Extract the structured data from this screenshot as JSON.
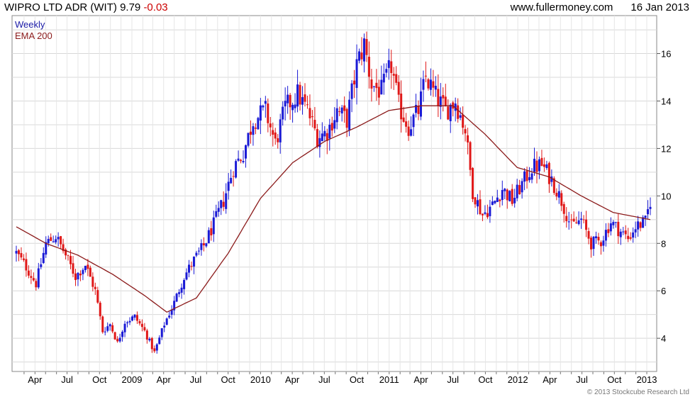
{
  "header": {
    "title": "WIPRO LTD ADR (WIT)",
    "last": "9.79",
    "change": "-0.03",
    "site": "www.fullermoney.com",
    "date": "16 Jan 2013"
  },
  "legend": {
    "weekly": "Weekly",
    "ema": "EMA 200"
  },
  "copyright": "© 2013 Stockcube Research Ltd",
  "colors": {
    "up": "#1a1ad6",
    "down": "#e01818",
    "ema": "#8b1a1a",
    "grid": "#d8d8d8"
  },
  "chart_data": {
    "type": "candlestick",
    "title": "WIPRO LTD ADR (WIT)",
    "frequency": "Weekly",
    "ylim": [
      2.6,
      17.6
    ],
    "yticks": [
      4,
      6,
      8,
      10,
      12,
      14,
      16
    ],
    "xticks": [
      {
        "label": "Apr",
        "date": "2008-04-01"
      },
      {
        "label": "Jul",
        "date": "2008-07-01"
      },
      {
        "label": "Oct",
        "date": "2008-10-01"
      },
      {
        "label": "2009",
        "date": "2009-01-01"
      },
      {
        "label": "Apr",
        "date": "2009-04-01"
      },
      {
        "label": "Jul",
        "date": "2009-07-01"
      },
      {
        "label": "Oct",
        "date": "2009-10-01"
      },
      {
        "label": "2010",
        "date": "2010-01-01"
      },
      {
        "label": "Apr",
        "date": "2010-04-01"
      },
      {
        "label": "Jul",
        "date": "2010-07-01"
      },
      {
        "label": "Oct",
        "date": "2010-10-01"
      },
      {
        "label": "2011",
        "date": "2011-01-01"
      },
      {
        "label": "Apr",
        "date": "2011-04-01"
      },
      {
        "label": "Jul",
        "date": "2011-07-01"
      },
      {
        "label": "Oct",
        "date": "2011-10-01"
      },
      {
        "label": "2012",
        "date": "2012-01-01"
      },
      {
        "label": "Apr",
        "date": "2012-04-01"
      },
      {
        "label": "Jul",
        "date": "2012-07-01"
      },
      {
        "label": "Oct",
        "date": "2012-10-01"
      },
      {
        "label": "2013",
        "date": "2013-01-01"
      }
    ],
    "price_series": {
      "name": "Weekly",
      "start": "2008-02-08",
      "weeks": 258,
      "anchors": [
        [
          "2008-02-08",
          7.6
        ],
        [
          "2008-03-07",
          7.0
        ],
        [
          "2008-04-04",
          6.3
        ],
        [
          "2008-05-02",
          8.0
        ],
        [
          "2008-05-30",
          8.3
        ],
        [
          "2008-06-27",
          7.5
        ],
        [
          "2008-07-25",
          6.6
        ],
        [
          "2008-08-22",
          7.1
        ],
        [
          "2008-09-19",
          6.0
        ],
        [
          "2008-10-10",
          4.3
        ],
        [
          "2008-10-31",
          4.6
        ],
        [
          "2008-11-21",
          3.8
        ],
        [
          "2008-12-12",
          4.7
        ],
        [
          "2009-01-09",
          4.9
        ],
        [
          "2009-02-06",
          4.3
        ],
        [
          "2009-03-06",
          3.4
        ],
        [
          "2009-04-03",
          4.6
        ],
        [
          "2009-05-01",
          5.5
        ],
        [
          "2009-05-29",
          6.6
        ],
        [
          "2009-06-26",
          7.3
        ],
        [
          "2009-07-24",
          7.9
        ],
        [
          "2009-08-21",
          8.8
        ],
        [
          "2009-09-18",
          9.8
        ],
        [
          "2009-10-16",
          11.2
        ],
        [
          "2009-11-13",
          11.8
        ],
        [
          "2009-12-11",
          13.2
        ],
        [
          "2010-01-15",
          13.6
        ],
        [
          "2010-02-12",
          12.2
        ],
        [
          "2010-03-12",
          13.7
        ],
        [
          "2010-04-16",
          14.3
        ],
        [
          "2010-05-14",
          13.6
        ],
        [
          "2010-06-11",
          12.5
        ],
        [
          "2010-07-09",
          12.7
        ],
        [
          "2010-08-06",
          13.6
        ],
        [
          "2010-09-03",
          13.2
        ],
        [
          "2010-10-01",
          15.5
        ],
        [
          "2010-10-22",
          16.4
        ],
        [
          "2010-11-12",
          14.7
        ],
        [
          "2010-12-10",
          14.4
        ],
        [
          "2011-01-07",
          15.5
        ],
        [
          "2011-01-28",
          13.8
        ],
        [
          "2011-02-25",
          12.9
        ],
        [
          "2011-03-25",
          13.6
        ],
        [
          "2011-04-15",
          15.0
        ],
        [
          "2011-05-13",
          14.2
        ],
        [
          "2011-06-10",
          13.6
        ],
        [
          "2011-07-08",
          14.0
        ],
        [
          "2011-08-05",
          12.8
        ],
        [
          "2011-08-26",
          10.2
        ],
        [
          "2011-09-23",
          9.2
        ],
        [
          "2011-10-21",
          9.6
        ],
        [
          "2011-11-18",
          10.3
        ],
        [
          "2011-12-16",
          9.8
        ],
        [
          "2012-01-13",
          10.5
        ],
        [
          "2012-02-10",
          11.2
        ],
        [
          "2012-03-09",
          11.3
        ],
        [
          "2012-04-06",
          10.7
        ],
        [
          "2012-05-04",
          9.8
        ],
        [
          "2012-06-01",
          8.7
        ],
        [
          "2012-06-29",
          9.0
        ],
        [
          "2012-07-27",
          8.0
        ],
        [
          "2012-08-24",
          8.1
        ],
        [
          "2012-09-21",
          8.9
        ],
        [
          "2012-10-19",
          8.5
        ],
        [
          "2012-11-09",
          8.2
        ],
        [
          "2012-11-30",
          8.7
        ],
        [
          "2012-12-28",
          8.9
        ],
        [
          "2013-01-11",
          9.8
        ]
      ]
    },
    "ema_series": {
      "name": "EMA 200",
      "anchors": [
        [
          "2008-02-08",
          8.7
        ],
        [
          "2008-05-02",
          8.0
        ],
        [
          "2008-08-01",
          7.5
        ],
        [
          "2008-11-07",
          6.7
        ],
        [
          "2009-02-06",
          5.8
        ],
        [
          "2009-04-10",
          5.1
        ],
        [
          "2009-07-03",
          5.7
        ],
        [
          "2009-10-02",
          7.6
        ],
        [
          "2010-01-01",
          9.9
        ],
        [
          "2010-04-02",
          11.4
        ],
        [
          "2010-07-02",
          12.3
        ],
        [
          "2010-10-01",
          12.9
        ],
        [
          "2010-12-31",
          13.6
        ],
        [
          "2011-04-01",
          13.8
        ],
        [
          "2011-07-01",
          13.8
        ],
        [
          "2011-09-30",
          12.6
        ],
        [
          "2011-12-30",
          11.2
        ],
        [
          "2012-03-30",
          10.8
        ],
        [
          "2012-06-29",
          10.0
        ],
        [
          "2012-09-28",
          9.3
        ],
        [
          "2013-01-11",
          9.0
        ]
      ]
    }
  }
}
